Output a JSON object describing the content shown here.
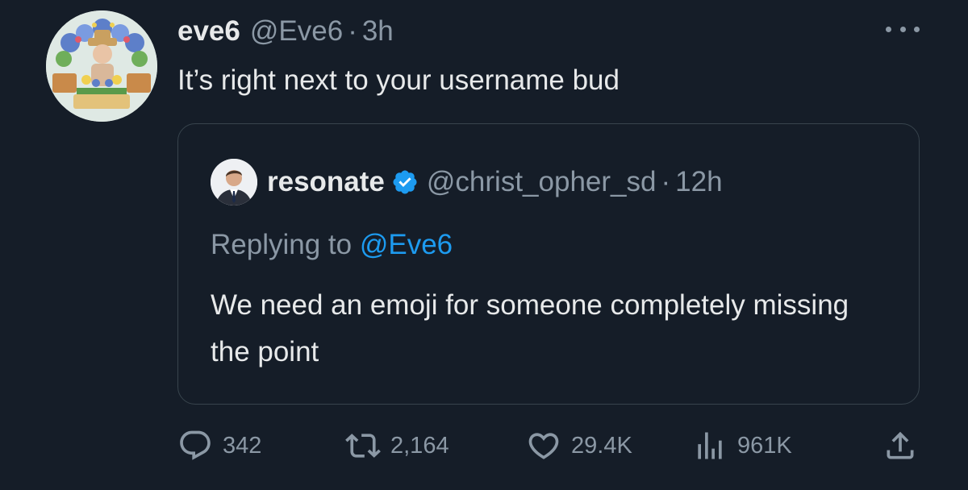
{
  "tweet": {
    "author": {
      "display_name": "eve6",
      "handle": "@Eve6",
      "avatar_icon": "profile-photo-flower-cart"
    },
    "separator": "·",
    "time": "3h",
    "text": "It’s right next to your username bud",
    "more_icon": "more-dots-icon"
  },
  "quoted_tweet": {
    "author": {
      "display_name": "resonate",
      "handle": "@christ_opher_sd",
      "verified": true,
      "avatar_icon": "profile-photo-man-suit"
    },
    "separator": "·",
    "time": "12h",
    "replying_prefix": "Replying to",
    "replying_to": "@Eve6",
    "text": "We need an emoji for someone completely missing the point"
  },
  "actions": {
    "replies": "342",
    "retweets": "2,164",
    "likes": "29.4K",
    "views": "961K",
    "icons": [
      "reply-icon",
      "retweet-icon",
      "like-icon",
      "views-icon",
      "share-icon"
    ]
  },
  "colors": {
    "background": "#151d28",
    "text_primary": "#e7e9ea",
    "text_secondary": "#8b98a5",
    "accent": "#1d9bf0",
    "border": "#38444d"
  }
}
